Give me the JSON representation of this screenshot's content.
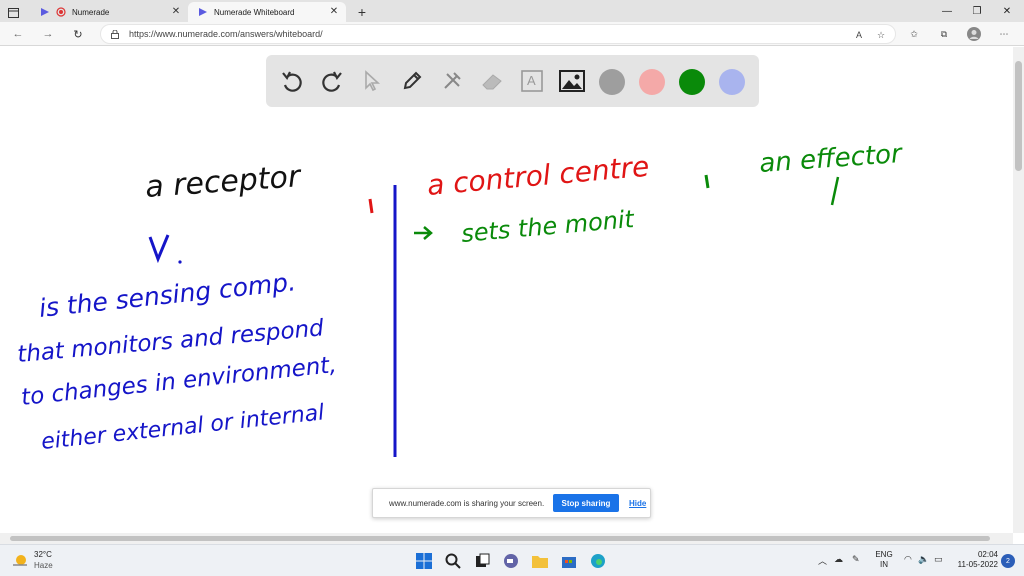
{
  "browser": {
    "tabs": [
      {
        "title": "Numerade",
        "active": false
      },
      {
        "title": "Numerade Whiteboard",
        "active": true
      }
    ],
    "new_tab_label": "+",
    "window_controls": {
      "minimize": "—",
      "maximize": "❐",
      "close": "✕"
    },
    "url": "https://www.numerade.com/answers/whiteboard/",
    "zoom_label": "A",
    "accent_color": "#1a73e8"
  },
  "whiteboard": {
    "tools": [
      "undo-icon",
      "redo-icon",
      "select-icon",
      "pen-icon",
      "tools-icon",
      "eraser-icon",
      "text-icon",
      "image-icon"
    ],
    "text_tool_label": "A",
    "colors": [
      "#9e9e9e",
      "#f4a9a8",
      "#0a8a0a",
      "#a9b4ee"
    ],
    "handwriting": {
      "left_heading": "a receptor",
      "left_body": [
        "is the sensing comp.",
        "that monitors and respond",
        "to changes in environment,",
        "either external or internal"
      ],
      "middle_heading": "a control centre",
      "middle_body": "sets the monit",
      "right_heading": "an effector"
    }
  },
  "share_banner": {
    "message": "www.numerade.com is sharing your screen.",
    "stop_label": "Stop sharing",
    "hide_label": "Hide"
  },
  "taskbar": {
    "weather_temp": "32°C",
    "weather_desc": "Haze",
    "lang_line1": "ENG",
    "lang_line2": "IN",
    "time": "02:04",
    "date": "11-05-2022",
    "notification_count": "2"
  }
}
